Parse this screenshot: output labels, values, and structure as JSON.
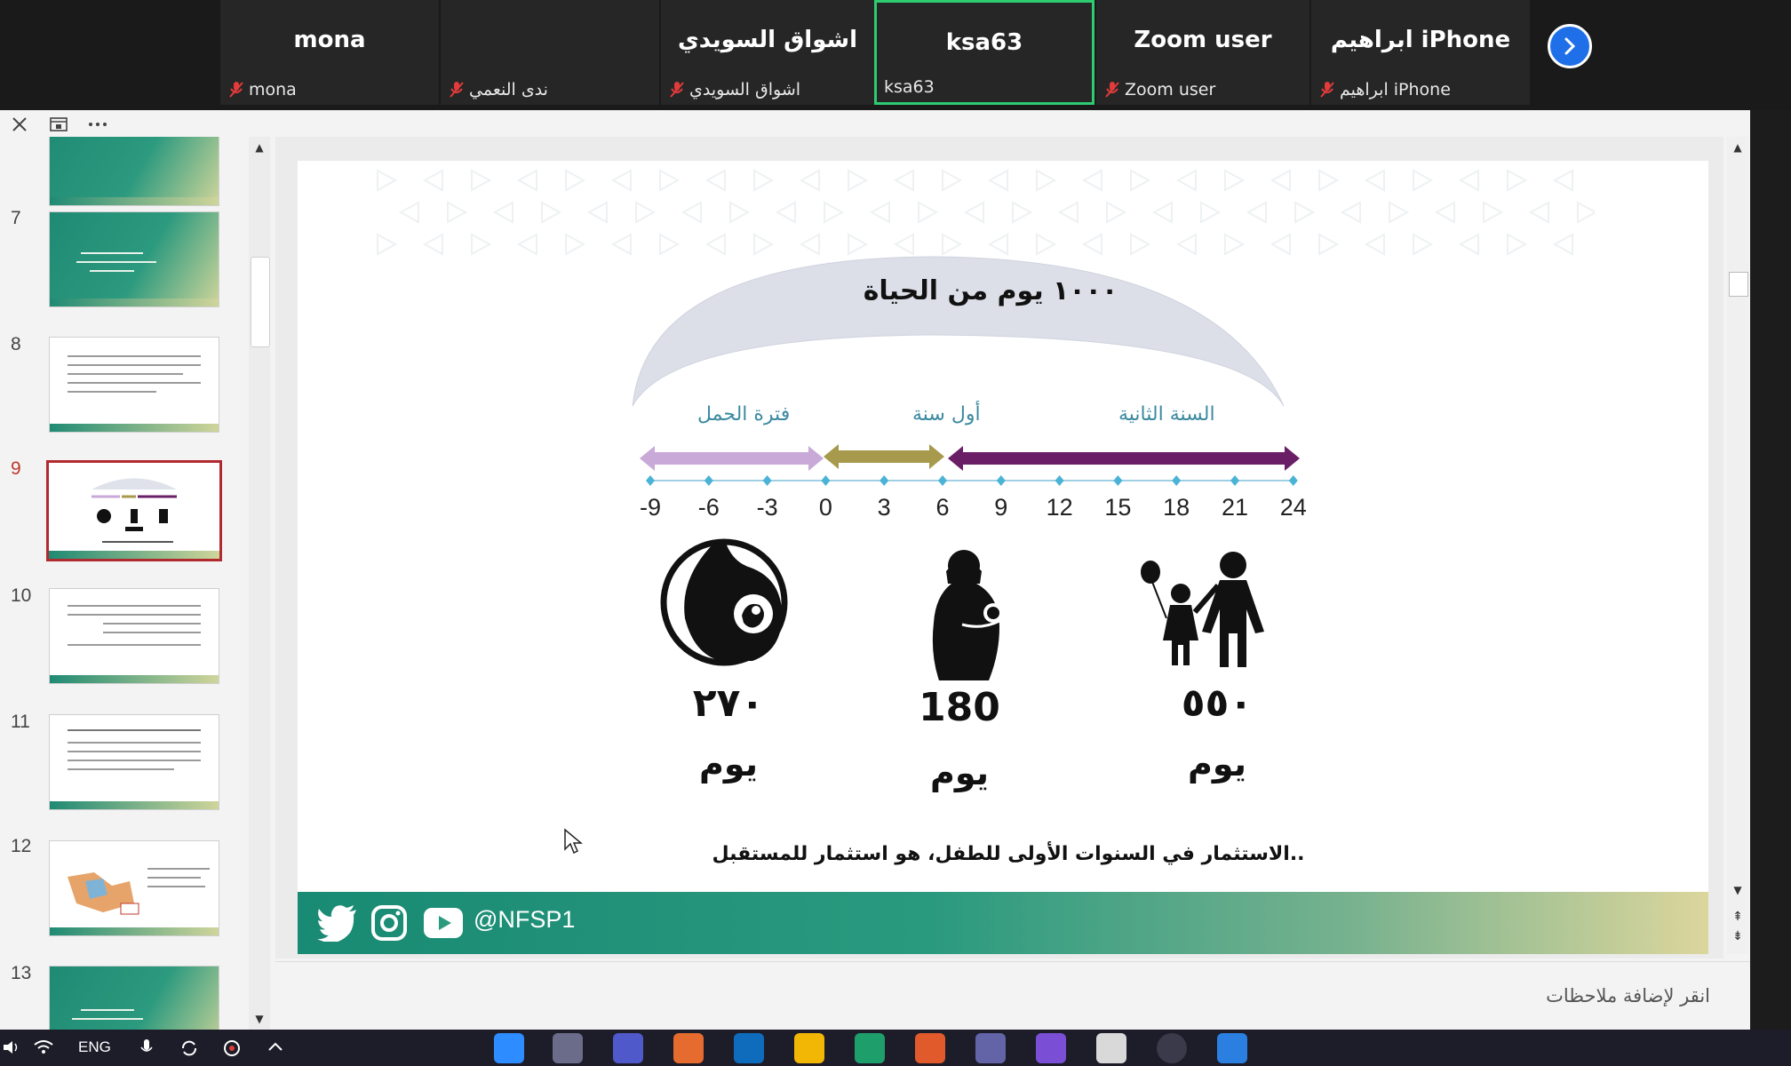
{
  "participants": [
    {
      "display_name": "mona",
      "label": "mona",
      "muted": true
    },
    {
      "display_name": "",
      "label": "ندى النعمي",
      "muted": true,
      "has_photo": true
    },
    {
      "display_name": "اشواق السويدي",
      "label": "اشواق السويدي",
      "muted": true
    },
    {
      "display_name": "ksa63",
      "label": "ksa63",
      "muted": false,
      "active_speaker": true
    },
    {
      "display_name": "Zoom user",
      "label": "Zoom user",
      "muted": true
    },
    {
      "display_name": "ابراهيم iPhone",
      "label": "ابراهيم iPhone",
      "muted": true
    }
  ],
  "thumbnails": [
    {
      "number": "",
      "style": "green"
    },
    {
      "number": "7",
      "style": "green"
    },
    {
      "number": "8",
      "style": "text"
    },
    {
      "number": "9",
      "style": "selected"
    },
    {
      "number": "10",
      "style": "text"
    },
    {
      "number": "11",
      "style": "text"
    },
    {
      "number": "12",
      "style": "map"
    },
    {
      "number": "13",
      "style": "green"
    }
  ],
  "slide": {
    "title": "١٠٠٠ يوم من الحياة",
    "segments": [
      {
        "label": "فترة الحمل",
        "color": "#c8a9d8"
      },
      {
        "label": "أول سنة",
        "color": "#a89a4c"
      },
      {
        "label": "السنة الثانية",
        "color": "#6a1e66"
      }
    ],
    "ticks": [
      "-9",
      "-6",
      "-3",
      "0",
      "3",
      "6",
      "9",
      "12",
      "15",
      "18",
      "21",
      "24"
    ],
    "counts": [
      {
        "value": "٢٧٠",
        "unit": "يوم"
      },
      {
        "value": "180",
        "unit": "يوم"
      },
      {
        "value": "٥٥٠",
        "unit": "يوم"
      }
    ],
    "tagline": "الاستثمار في السنوات الأولى للطفل، هو استثمار للمستقبل..",
    "handle": "@NFSP1"
  },
  "notes_placeholder": "انقر لإضافة ملاحظات",
  "taskbar": {
    "lang": "ENG"
  }
}
